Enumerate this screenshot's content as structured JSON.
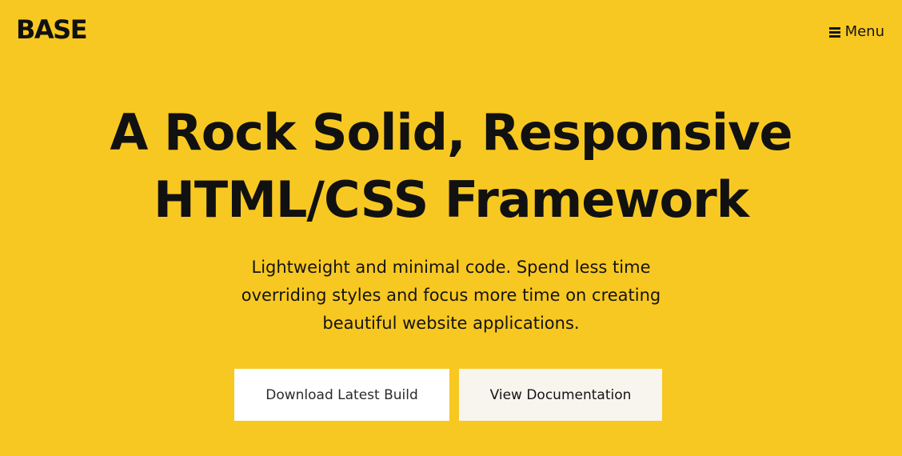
{
  "header": {
    "logo": "BASE",
    "menu_label": "Menu",
    "menu_icon": "hamburger-icon"
  },
  "hero": {
    "title_lines": [
      "A Rock Solid, Responsive",
      "HTML/CSS Framework"
    ],
    "subtitle_lines": [
      "Lightweight and minimal code. Spend less time",
      "overriding styles and focus more time on creating",
      "beautiful website applications."
    ]
  },
  "actions": {
    "download_label": "Download Latest Build",
    "docs_label": "View Documentation"
  },
  "colors": {
    "background": "#F8C822",
    "text": "#141414",
    "primary_button_bg": "#FFFFFF",
    "secondary_button_bg": "#F8F4EE"
  }
}
